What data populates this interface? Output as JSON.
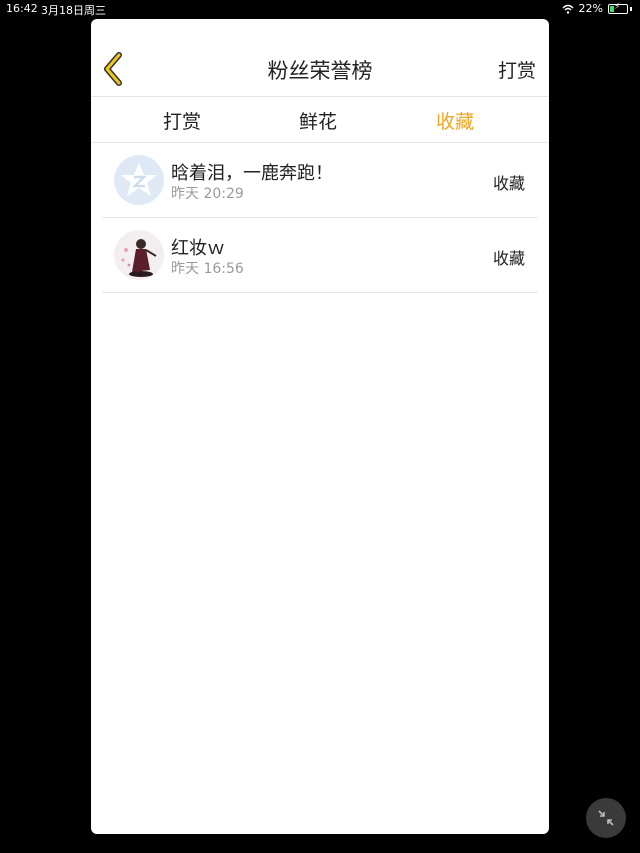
{
  "status_bar": {
    "time": "16:42",
    "date": "3月18日周三",
    "battery_percent": "22%",
    "battery_level": 0.22
  },
  "nav": {
    "back_icon": "chevron-left-icon",
    "title": "粉丝荣誉榜",
    "right_action": "打赏"
  },
  "tabs": [
    {
      "label": "打赏",
      "active": false
    },
    {
      "label": "鲜花",
      "active": false
    },
    {
      "label": "收藏",
      "active": true
    }
  ],
  "colors": {
    "accent": "#f0a623",
    "text": "#222222",
    "muted": "#9a9a9a",
    "divider": "#e6e6e6"
  },
  "rows": [
    {
      "avatar": "default-star-avatar",
      "name": "晗着泪，一鹿奔跑！",
      "time": "昨天 20:29",
      "action": "收藏"
    },
    {
      "avatar": "user-photo-avatar",
      "name": "红妆ｗ",
      "time": "昨天 16:56",
      "action": "收藏"
    }
  ],
  "float_button": {
    "icon": "collapse-arrows-icon"
  }
}
